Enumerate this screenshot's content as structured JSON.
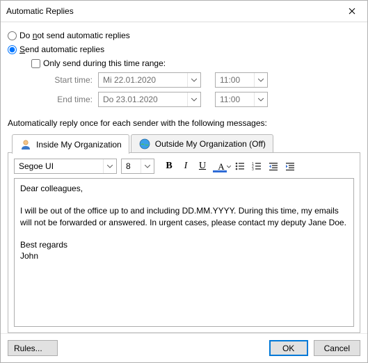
{
  "window": {
    "title": "Automatic Replies"
  },
  "options": {
    "do_not_send": "Do not send automatic replies",
    "send": "Send automatic replies",
    "only_during": "Only send during this time range:",
    "start_label": "Start time:",
    "end_label": "End time:",
    "start_date": "Mi 22.01.2020",
    "start_time": "11:00",
    "end_date": "Do 23.01.2020",
    "end_time": "11:00"
  },
  "section_text": "Automatically reply once for each sender with the following messages:",
  "tabs": {
    "inside": "Inside My Organization",
    "outside": "Outside My Organization (Off)"
  },
  "toolbar": {
    "font": "Segoe UI",
    "size": "8"
  },
  "message": "Dear colleagues,\n\nI will be out of the office up to and including DD.MM.YYYY. During this time, my emails will not be forwarded or answered. In urgent cases, please contact my deputy Jane Doe.\n\nBest regards\nJohn",
  "footer": {
    "rules": "Rules...",
    "ok": "OK",
    "cancel": "Cancel"
  }
}
